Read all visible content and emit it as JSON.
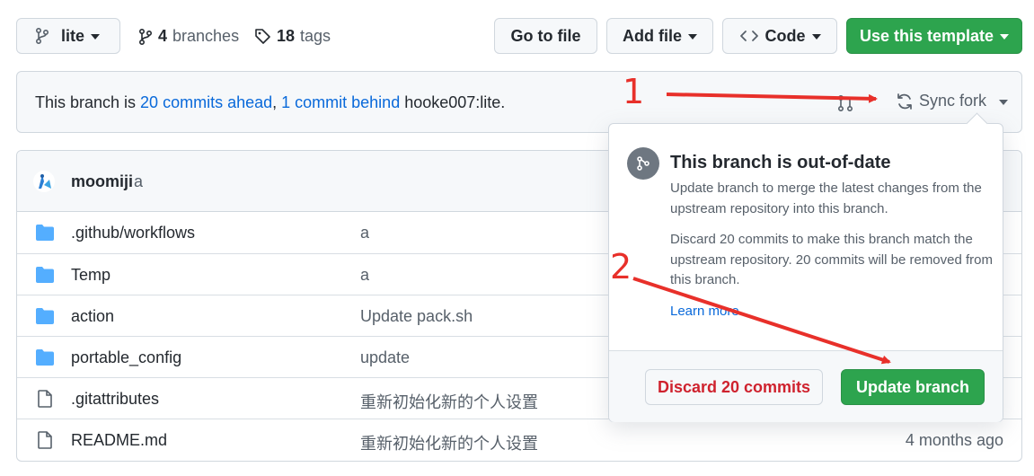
{
  "toolbar": {
    "branch": "lite",
    "branches_count": "4",
    "branches_label": "branches",
    "tags_count": "18",
    "tags_label": "tags",
    "go_to_file": "Go to file",
    "add_file": "Add file",
    "code": "Code",
    "use_template": "Use this template"
  },
  "banner": {
    "prefix": "This branch is ",
    "ahead": "20 commits ahead",
    "sep": ", ",
    "behind": "1 commit behind",
    "upstream": " hooke007:lite.",
    "sync_fork": "Sync fork"
  },
  "commit": {
    "author": "moomiji",
    "message": "a"
  },
  "files": [
    {
      "name": ".github/workflows",
      "type": "dir",
      "message": "a",
      "age": ""
    },
    {
      "name": "Temp",
      "type": "dir",
      "message": "a",
      "age": ""
    },
    {
      "name": "action",
      "type": "dir",
      "message": "Update pack.sh",
      "age": ""
    },
    {
      "name": "portable_config",
      "type": "dir",
      "message": "update",
      "age": ""
    },
    {
      "name": ".gitattributes",
      "type": "file",
      "message": "重新初始化新的个人设置",
      "age": ""
    },
    {
      "name": "README.md",
      "type": "file",
      "message": "重新初始化新的个人设置",
      "age": "4 months ago"
    }
  ],
  "popover": {
    "title": "This branch is out-of-date",
    "para1": "Update branch to merge the latest changes from the upstream repository into this branch.",
    "para2": "Discard 20 commits to make this branch match the upstream repository. 20 commits will be removed from this branch.",
    "learn_more": "Learn more",
    "discard": "Discard 20 commits",
    "update": "Update branch"
  },
  "annotations": {
    "one": "1",
    "two": "2"
  },
  "colors": {
    "green": "#2da44e",
    "link": "#0969da",
    "danger": "#cf222e",
    "annotation": "#e8302a",
    "folder": "#54aeff"
  },
  "icons": [
    "branch-icon",
    "tag-icon",
    "code-icon",
    "sync-icon",
    "git-branch-circle-icon",
    "folder-icon",
    "file-icon",
    "avatar"
  ]
}
